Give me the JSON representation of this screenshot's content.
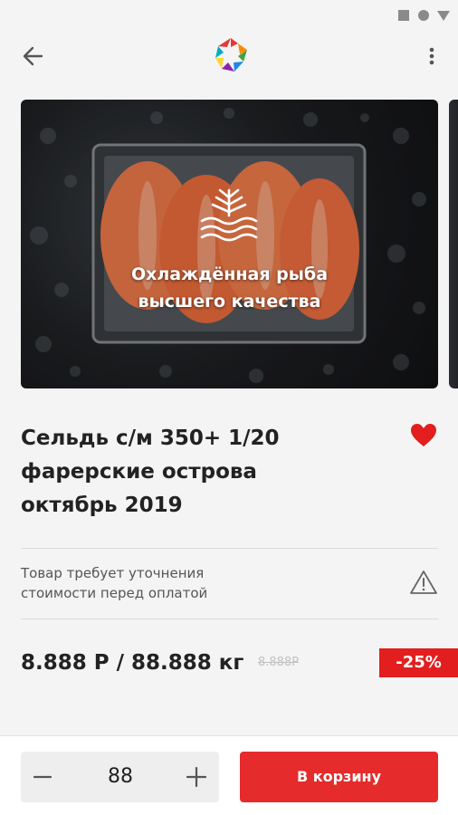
{
  "status_bar": {
    "icons": [
      "square-icon",
      "circle-icon",
      "triangle-icon"
    ]
  },
  "toolbar": {
    "back_icon": "arrow-left-icon",
    "logo_icon": "colorful-pentagon-logo",
    "more_icon": "more-vertical-icon"
  },
  "hero": {
    "caption_line1": "Охлаждённая рыба",
    "caption_line2": "высшего качества",
    "emblem_icon": "snowflake-waves-icon"
  },
  "product": {
    "title_lines": [
      "Сельдь с/м 350+ 1/20",
      "фарерские острова",
      "октябрь 2019"
    ],
    "favorite_icon": "heart-icon",
    "note_lines": [
      "Товар требует уточнения",
      "стоимости перед оплатой"
    ],
    "warning_icon": "warning-triangle-icon",
    "price": "8.888 Р / 88.888 кг",
    "old_price": "8.888Р",
    "discount": "-25%"
  },
  "cart": {
    "quantity": "88",
    "minus_icon": "minus-icon",
    "plus_icon": "plus-icon",
    "add_label": "В корзину"
  },
  "colors": {
    "accent": "#e52b2b",
    "discount": "#e31e1e",
    "heart": "#e31e1e",
    "background": "#f4f4f4"
  }
}
